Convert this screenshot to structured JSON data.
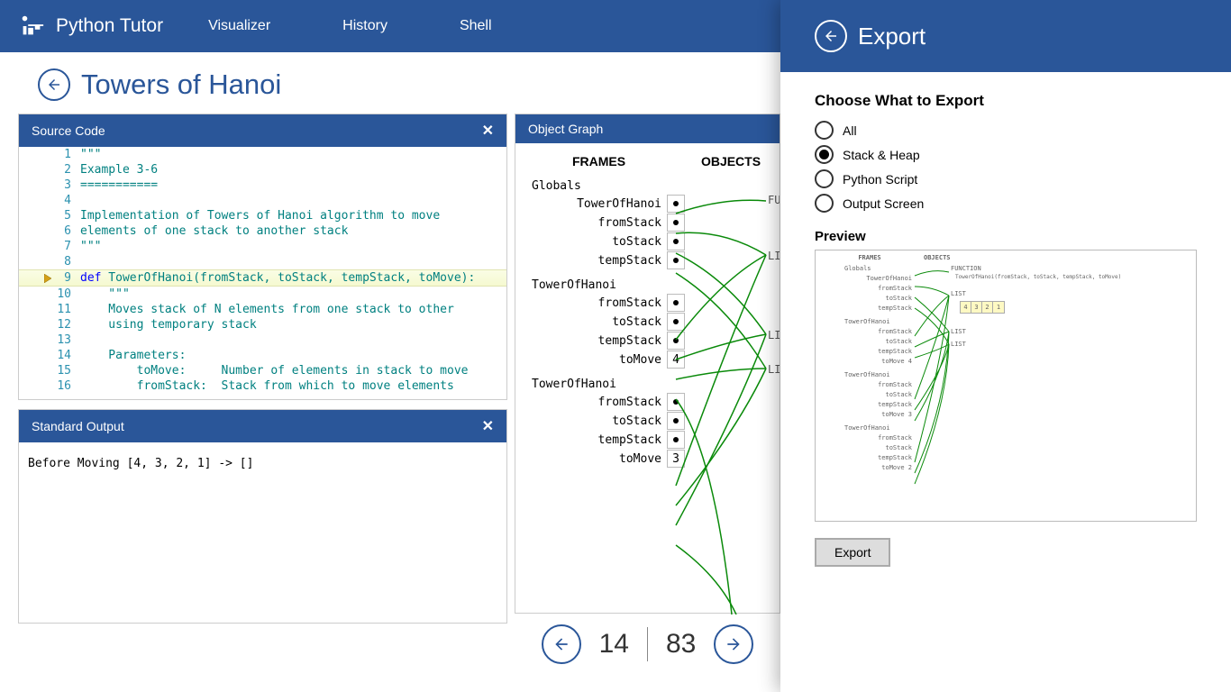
{
  "app": {
    "title": "Python Tutor"
  },
  "nav": {
    "visualizer": "Visualizer",
    "history": "History",
    "shell": "Shell"
  },
  "page": {
    "title": "Towers of Hanoi"
  },
  "panels": {
    "source": {
      "title": "Source Code"
    },
    "output": {
      "title": "Standard Output"
    },
    "graph": {
      "title": "Object Graph"
    }
  },
  "code": {
    "lines": [
      "\"\"\"",
      "Example 3-6",
      "===========",
      "",
      "Implementation of Towers of Hanoi algorithm to move",
      "elements of one stack to another stack",
      "\"\"\"",
      "",
      "def TowerOfHanoi(fromStack, toStack, tempStack, toMove):",
      "    \"\"\"",
      "    Moves stack of N elements from one stack to other",
      "    using temporary stack",
      "",
      "    Parameters:",
      "        toMove:     Number of elements in stack to move",
      "        fromStack:  Stack from which to move elements"
    ],
    "current_line": 9
  },
  "output": {
    "text": "Before Moving [4, 3, 2, 1] -> []"
  },
  "graph": {
    "headers": {
      "frames": "FRAMES",
      "objects": "OBJECTS"
    },
    "frames": [
      {
        "title": "Globals",
        "vars": [
          {
            "name": "TowerOfHanoi",
            "val": ""
          },
          {
            "name": "fromStack",
            "val": ""
          },
          {
            "name": "toStack",
            "val": ""
          },
          {
            "name": "tempStack",
            "val": ""
          }
        ]
      },
      {
        "title": "TowerOfHanoi",
        "vars": [
          {
            "name": "fromStack",
            "val": ""
          },
          {
            "name": "toStack",
            "val": ""
          },
          {
            "name": "tempStack",
            "val": ""
          },
          {
            "name": "toMove",
            "val": "4"
          }
        ]
      },
      {
        "title": "TowerOfHanoi",
        "vars": [
          {
            "name": "fromStack",
            "val": ""
          },
          {
            "name": "toStack",
            "val": ""
          },
          {
            "name": "tempStack",
            "val": ""
          },
          {
            "name": "toMove",
            "val": "3"
          }
        ]
      }
    ],
    "objects": [
      "FUNCTION",
      "LIST",
      "LIST",
      "LIST"
    ]
  },
  "step": {
    "current": "14",
    "total": "83"
  },
  "export": {
    "title": "Export",
    "choose_label": "Choose What to Export",
    "options": {
      "all": "All",
      "stack_heap": "Stack & Heap",
      "script": "Python Script",
      "output": "Output Screen"
    },
    "selected": "stack_heap",
    "preview_label": "Preview",
    "button": "Export",
    "preview": {
      "headers": {
        "frames": "FRAMES",
        "objects": "OBJECTS"
      },
      "func_sig": "TowerOfHanoi(fromStack, toStack, tempStack, toMove)",
      "list_label": "LIST",
      "list_values": [
        "4",
        "3",
        "2",
        "1"
      ],
      "frames": [
        {
          "title": "Globals",
          "vars": [
            "TowerOfHanoi",
            "fromStack",
            "toStack",
            "tempStack"
          ]
        },
        {
          "title": "TowerOfHanoi",
          "vars": [
            "fromStack",
            "toStack",
            "tempStack",
            "toMove"
          ],
          "last_val": "4"
        },
        {
          "title": "TowerOfHanoi",
          "vars": [
            "fromStack",
            "toStack",
            "tempStack",
            "toMove"
          ],
          "last_val": "3"
        },
        {
          "title": "TowerOfHanoi",
          "vars": [
            "fromStack",
            "toStack",
            "tempStack",
            "toMove"
          ],
          "last_val": "2"
        }
      ]
    }
  }
}
